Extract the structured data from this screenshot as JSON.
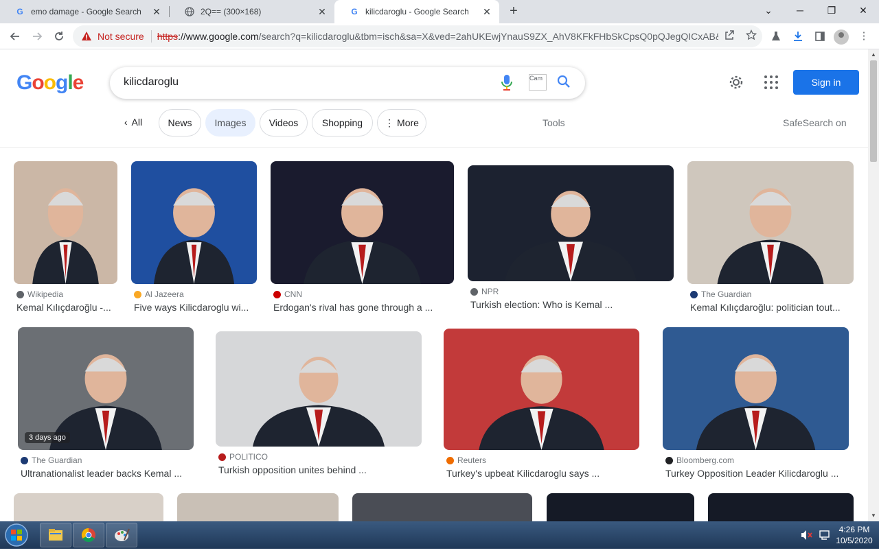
{
  "tabs": [
    {
      "title": "emo damage - Google Search",
      "favicon": "google-g-icon",
      "active": false
    },
    {
      "title": "2Q== (300×168)",
      "favicon": "globe-icon",
      "active": false
    },
    {
      "title": "kilicdaroglu - Google Search",
      "favicon": "google-g-icon",
      "active": true
    }
  ],
  "toolbar": {
    "security_label": "Not secure",
    "url_scheme": "https",
    "url_host": "://www.google.com",
    "url_rest": "/search?q=kilicdaroglu&tbm=isch&sa=X&ved=2ahUKEwjYnauS9ZX_AhV8KFkFHbSkCpsQ0pQJegQICxAB&..."
  },
  "google": {
    "logo": "Google",
    "query": "kilicdaroglu",
    "lens_alt": "Cam",
    "sign_in": "Sign in",
    "chips": [
      "All",
      "News",
      "Images",
      "Videos",
      "Shopping",
      "More"
    ],
    "selected_chip": "Images",
    "tools": "Tools",
    "safesearch": "SafeSearch on"
  },
  "results": [
    {
      "source": "Wikipedia",
      "caption": "Kemal Kılıçdaroğlu -...",
      "badge": "",
      "bg": "#cbb7a6"
    },
    {
      "source": "Al Jazeera",
      "caption": "Five ways Kilicdaroglu wi...",
      "badge": "",
      "bg": "#1f4fa0"
    },
    {
      "source": "CNN",
      "caption": "Erdogan's rival has gone through a ...",
      "badge": "",
      "bg": "#1a1b2e"
    },
    {
      "source": "NPR",
      "caption": "Turkish election: Who is Kemal ...",
      "badge": "",
      "bg": "#1c2230"
    },
    {
      "source": "The Guardian",
      "caption": "Kemal Kılıçdaroğlu: politician tout...",
      "badge": "",
      "bg": "#cfc7bd"
    },
    {
      "source": "The Guardian",
      "caption": "Ultranationalist leader backs Kemal ...",
      "badge": "3 days ago",
      "bg": "#6b6f74"
    },
    {
      "source": "POLITICO",
      "caption": "Turkish opposition unites behind ...",
      "badge": "",
      "bg": "#d6d7d9"
    },
    {
      "source": "Reuters",
      "caption": "Turkey's upbeat Kilicdaroglu says ...",
      "badge": "",
      "bg": "#c23a3a"
    },
    {
      "source": "Bloomberg.com",
      "caption": "Turkey Opposition Leader Kilicdaroglu ...",
      "badge": "",
      "bg": "#2f5a92"
    }
  ],
  "taskbar": {
    "time": "4:26 PM",
    "date": "10/5/2020"
  }
}
